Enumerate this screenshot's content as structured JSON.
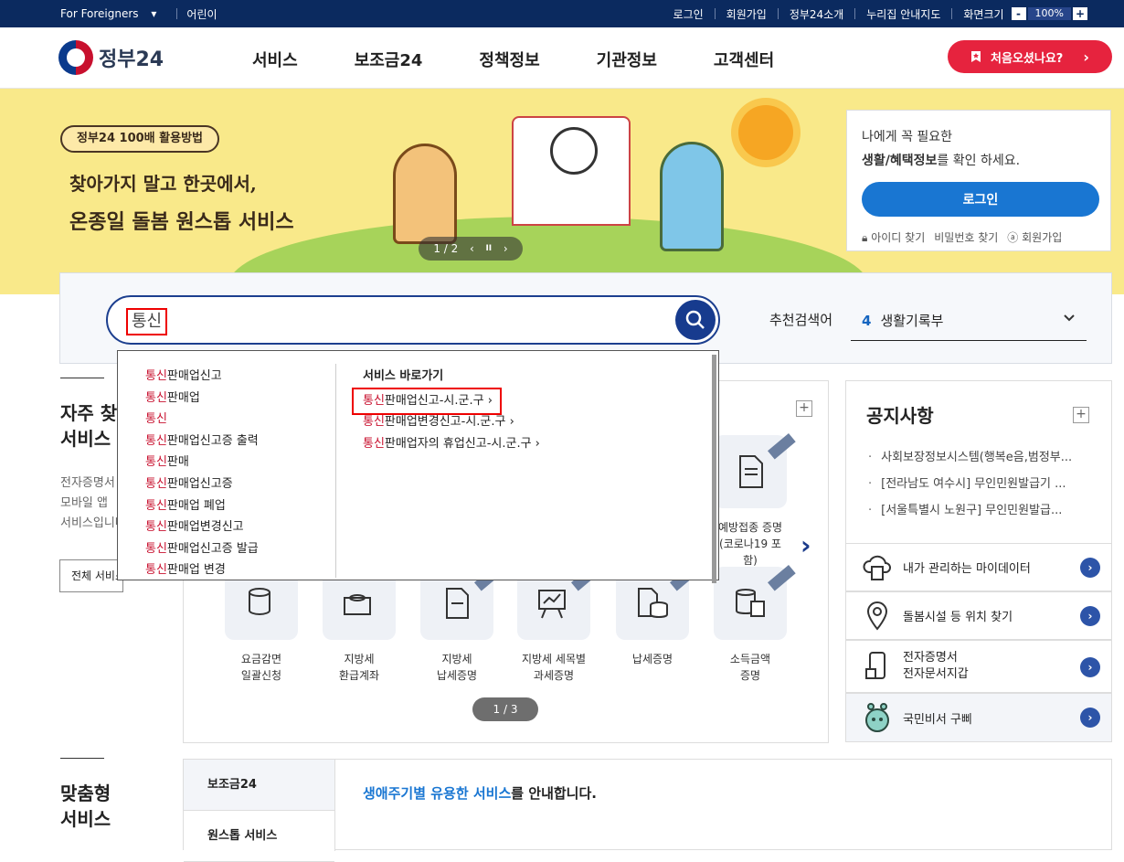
{
  "util": {
    "foreigners": "For Foreigners",
    "kids": "어린이",
    "links": [
      "로그인",
      "회원가입",
      "정부24소개",
      "누리집 안내지도"
    ],
    "zoom_label": "화면크기",
    "zoom_minus": "-",
    "zoom_value": "100%",
    "zoom_plus": "+"
  },
  "header": {
    "logo_text": "정부24",
    "nav": [
      "서비스",
      "보조금24",
      "정책정보",
      "기관정보",
      "고객센터"
    ],
    "first_visit": "처음오셨나요?",
    "first_visit_arrow": "›"
  },
  "banner": {
    "badge": "정부24 100배 활용방법",
    "line1": "찾아가지 말고 한곳에서,",
    "line2": "온종일 돌봄 원스톱 서비스",
    "pager": "1 / 2",
    "prev": "‹",
    "pause": "II",
    "next": "›"
  },
  "login_box": {
    "line1": "나에게 꼭 필요한",
    "line2_bold": "생활/혜택정보",
    "line2_rest": "를 확인 하세요.",
    "login": "로그인",
    "find_id": "아이디 찾기",
    "find_pw": "비밀번호 찾기",
    "join": "회원가입"
  },
  "search": {
    "query": "통신",
    "rec_label": "추천검색어",
    "rec_num": "4",
    "rec_term": "생활기록부"
  },
  "autocomplete": {
    "keyword": "통신",
    "suggestions": [
      "판매업신고",
      "판매업",
      "",
      "판매업신고증 출력",
      "판매",
      "판매업신고증",
      "판매업 폐업",
      "판매업변경신고",
      "판매업신고증 발급",
      "판매업 변경"
    ],
    "shortcut_title": "서비스 바로가기",
    "shortcuts": [
      "판매업신고-시.군.구 ›",
      "판매업변경신고-시.군.구 ›",
      "판매업자의 휴업신고-시.군.구 ›"
    ]
  },
  "frequent": {
    "title1": "자주 찾는",
    "title2": "서비스",
    "desc": [
      "전자증명서",
      "모바일 앱",
      "서비스입니다"
    ],
    "all_btn": "전체 서비스",
    "tiles": [
      {
        "l1": "예방접종 증명",
        "l2": "(코로나19 포함)"
      },
      {
        "l1": "요금감면",
        "l2": "일괄신청"
      },
      {
        "l1": "지방세",
        "l2": "환급계좌"
      },
      {
        "l1": "지방세",
        "l2": "납세증명"
      },
      {
        "l1": "지방세 세목별",
        "l2": "과세증명"
      },
      {
        "l1": "납세증명",
        "l2": ""
      },
      {
        "l1": "소득금액",
        "l2": "증명"
      }
    ],
    "pager": "1 / 3",
    "next": "›",
    "plus": "+"
  },
  "notice": {
    "title": "공지사항",
    "plus": "+",
    "items": [
      "사회보장정보시스템(행복e음,범정부...",
      "[전라남도 여수시] 무인민원발급기 ...",
      "[서울특별시 노원구] 무인민원발급..."
    ]
  },
  "quick": [
    {
      "l1": "내가 관리하는 마이데이터",
      "l2": ""
    },
    {
      "l1": "돌봄시설 등 위치 찾기",
      "l2": ""
    },
    {
      "l1": "전자증명서",
      "l2": "전자문서지갑"
    },
    {
      "l1": "국민비서 구삐",
      "l2": ""
    }
  ],
  "quick_go": "›",
  "custom": {
    "title1": "맞춤형",
    "title2": "서비스",
    "tabs": [
      "보조금24",
      "원스톱 서비스"
    ],
    "msg_em": "생애주기별 유용한 서비스",
    "msg_rest": "를 안내합니다."
  },
  "colors": {
    "navy": "#0b2a5f",
    "accent": "#e6233e",
    "blue": "#1976d2",
    "highlight": "#c8102e"
  }
}
